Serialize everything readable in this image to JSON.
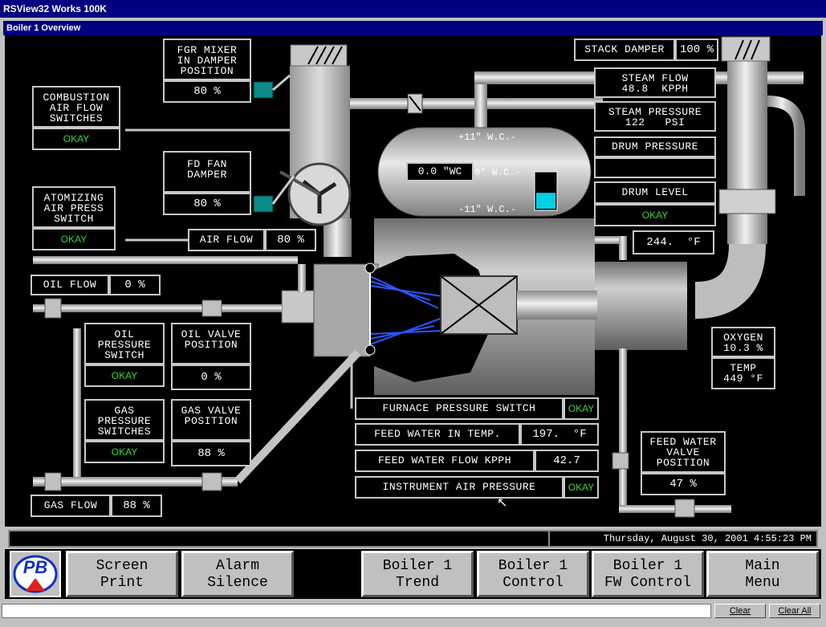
{
  "window": {
    "title": "RSView32 Works 100K",
    "subtitle": "Boiler 1 Overview"
  },
  "labels": {
    "fgr_mixer": "FGR MIXER\nIN DAMPER\nPOSITION",
    "fgr_mixer_val": "80 %",
    "combustion": "COMBUSTION\nAIR FLOW\nSWITCHES",
    "combustion_status": "OKAY",
    "fd_fan": "FD FAN\nDAMPER",
    "fd_fan_val": "80 %",
    "atomizing": "ATOMIZING\nAIR PRESS\nSWITCH",
    "atomizing_status": "OKAY",
    "air_flow": "AIR FLOW",
    "air_flow_val": "80 %",
    "oil_flow": "OIL FLOW",
    "oil_flow_val": "0 %",
    "oil_pressure": "OIL\nPRESSURE\nSWITCH",
    "oil_pressure_status": "OKAY",
    "oil_valve": "OIL VALVE\nPOSITION",
    "oil_valve_val": "0 %",
    "gas_pressure": "GAS\nPRESSURE\nSWITCHES",
    "gas_pressure_status": "OKAY",
    "gas_valve": "GAS VALVE\nPOSITION",
    "gas_valve_val": "88 %",
    "gas_flow": "GAS FLOW",
    "gas_flow_val": "88 %",
    "stack_damper": "STACK DAMPER",
    "stack_damper_val": "100 %",
    "steam_flow": "STEAM FLOW\n48.8  KPPH",
    "steam_pressure": "STEAM PRESSURE\n122   PSI",
    "drum_pressure": "DRUM PRESSURE",
    "drum_pressure_val": "",
    "drum_level": "DRUM LEVEL",
    "drum_level_status": "OKAY",
    "stack_temp_val": "244.  °F",
    "oxygen": "OXYGEN\n10.3 %",
    "temp": "TEMP\n449 °F",
    "furnace_pressure": "FURNACE PRESSURE SWITCH",
    "furnace_pressure_status": "OKAY",
    "feed_water_temp": "FEED WATER IN TEMP.",
    "feed_water_temp_val": "197.  °F",
    "feed_water_flow": "FEED WATER FLOW KPPH",
    "feed_water_flow_val": "42.7",
    "instrument_air": "INSTRUMENT AIR PRESSURE",
    "instrument_air_status": "OKAY",
    "fw_valve": "FEED WATER\nVALVE\nPOSITION",
    "fw_valve_val": "47 %",
    "drum_wc_val": "0.0 \"WC",
    "gauge_high": "+11\" W.C.-",
    "gauge_mid": "0\" W.C.-",
    "gauge_low": "-11\" W.C.-"
  },
  "status": {
    "datetime": "Thursday, August 30, 2001   4:55:23 PM"
  },
  "buttons": {
    "screen_print": "Screen\nPrint",
    "alarm_silence": "Alarm\nSilence",
    "boiler_trend": "Boiler 1\nTrend",
    "boiler_control": "Boiler 1\nControl",
    "boiler_fw": "Boiler 1\nFW Control",
    "main_menu": "Main\nMenu",
    "clear": "Clear",
    "clear_all": "Clear All"
  },
  "logo": {
    "text": "PB"
  },
  "colors": {
    "ok": "#3cd53c",
    "pipe": "#c4c4c4",
    "level": "#00d0e0",
    "flame": "#2a55ff",
    "valve": "#008080"
  },
  "drum_level_fraction": 0.45
}
